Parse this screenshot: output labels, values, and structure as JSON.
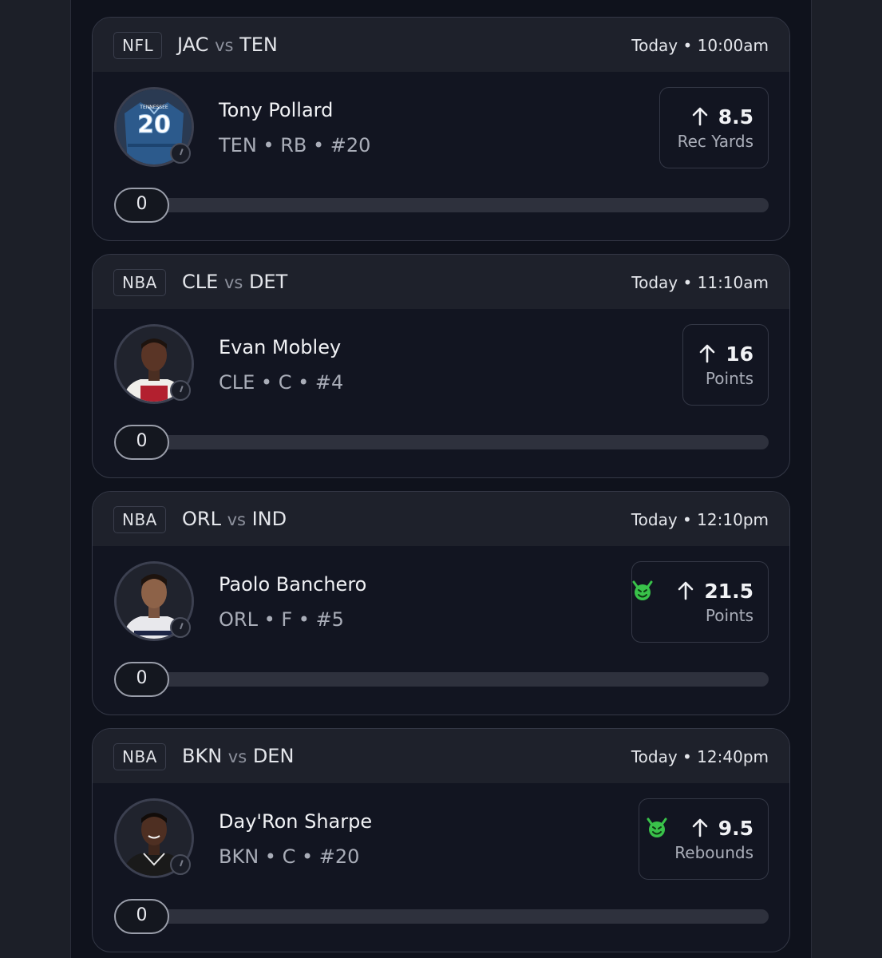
{
  "cards": [
    {
      "league": "NFL",
      "team_a": "JAC",
      "vs": "vs",
      "team_b": "TEN",
      "time": "Today • 10:00am",
      "player": {
        "name": "Tony Pollard",
        "info": "TEN • RB • #20",
        "avatar": "jersey-avatar"
      },
      "stat": {
        "direction": "up",
        "value": "8.5",
        "label": "Rec Yards",
        "demon": false
      },
      "progress": {
        "current": "0",
        "fraction": 0
      }
    },
    {
      "league": "NBA",
      "team_a": "CLE",
      "vs": "vs",
      "team_b": "DET",
      "time": "Today • 11:10am",
      "player": {
        "name": "Evan Mobley",
        "info": "CLE • C • #4",
        "avatar": "headshot-avatar"
      },
      "stat": {
        "direction": "up",
        "value": "16",
        "label": "Points",
        "demon": false
      },
      "progress": {
        "current": "0",
        "fraction": 0
      }
    },
    {
      "league": "NBA",
      "team_a": "ORL",
      "vs": "vs",
      "team_b": "IND",
      "time": "Today • 12:10pm",
      "player": {
        "name": "Paolo Banchero",
        "info": "ORL • F • #5",
        "avatar": "headshot-avatar"
      },
      "stat": {
        "direction": "up",
        "value": "21.5",
        "label": "Points",
        "demon": true
      },
      "progress": {
        "current": "0",
        "fraction": 0
      }
    },
    {
      "league": "NBA",
      "team_a": "BKN",
      "vs": "vs",
      "team_b": "DEN",
      "time": "Today • 12:40pm",
      "player": {
        "name": "Day'Ron Sharpe",
        "info": "BKN • C • #20",
        "avatar": "headshot-avatar"
      },
      "stat": {
        "direction": "up",
        "value": "9.5",
        "label": "Rebounds",
        "demon": true
      },
      "progress": {
        "current": "0",
        "fraction": 0
      }
    }
  ],
  "jersey": {
    "text": "TENNESSEE",
    "number": "20"
  },
  "colors": {
    "background": "#0f121c",
    "card_header": "#1e212b",
    "demon_green": "#39c24a",
    "jersey_blue": "#2c5a8c",
    "cavs_red": "#b3202f",
    "magic_navy": "#1d2545",
    "nets_black": "#1a1a1a"
  }
}
